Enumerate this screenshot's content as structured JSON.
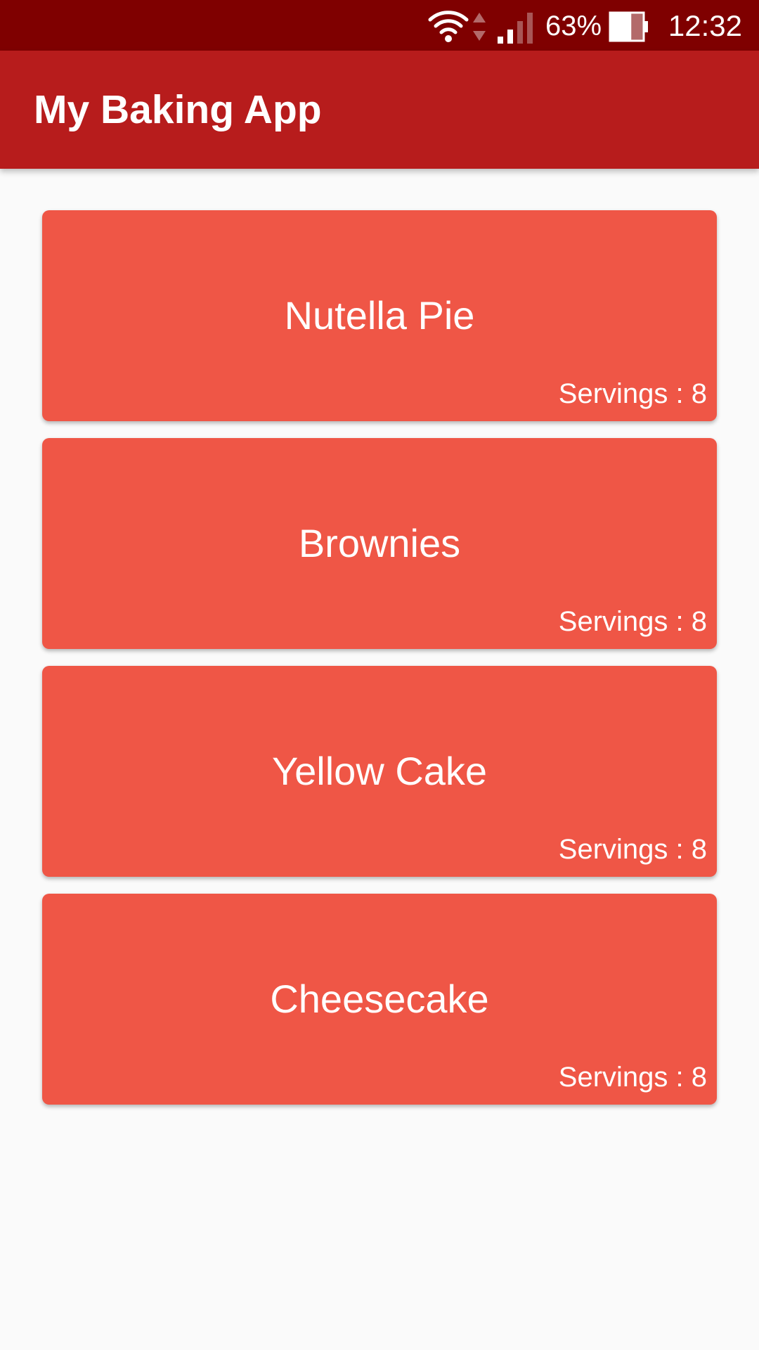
{
  "status_bar": {
    "battery_percent": "63%",
    "time": "12:32",
    "battery_level": 0.63,
    "icons": [
      "wifi-icon",
      "data-activity-icon",
      "cell-signal-icon",
      "battery-icon"
    ]
  },
  "app_bar": {
    "title": "My Baking App"
  },
  "colors": {
    "status_bar": "#7f0000",
    "app_bar": "#b71c1c",
    "card": "#ef5646",
    "background": "#fafafa",
    "text": "#ffffff"
  },
  "recipes": [
    {
      "name": "Nutella Pie",
      "servings": "Servings : 8"
    },
    {
      "name": "Brownies",
      "servings": "Servings : 8"
    },
    {
      "name": "Yellow Cake",
      "servings": "Servings : 8"
    },
    {
      "name": "Cheesecake",
      "servings": "Servings : 8"
    }
  ]
}
